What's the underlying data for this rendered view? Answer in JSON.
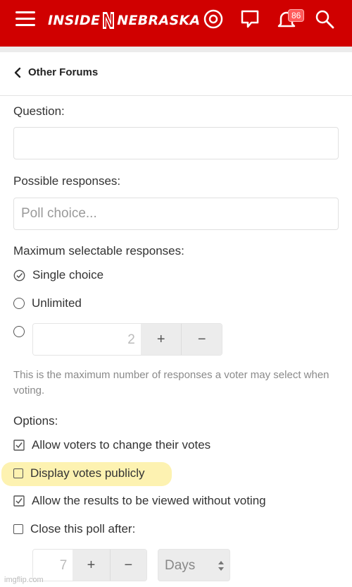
{
  "header": {
    "logo_left": "INSIDE",
    "logo_right": "NEBRASKA",
    "notification_count": "86",
    "icons": [
      "menu-icon",
      "account-icon",
      "conversations-icon",
      "alerts-icon",
      "search-icon"
    ]
  },
  "breadcrumb": {
    "label": "Other Forums"
  },
  "form": {
    "question_label": "Question:",
    "question_value": "",
    "responses_label": "Possible responses:",
    "poll_choice_placeholder": "Poll choice...",
    "max_label": "Maximum selectable responses:",
    "single_choice": "Single choice",
    "unlimited": "Unlimited",
    "max_value": "2",
    "plus": "+",
    "minus": "−",
    "help_text": "This is the maximum number of responses a voter may select when voting.",
    "options_label": "Options:",
    "opt_change_votes": "Allow voters to change their votes",
    "opt_display_public": "Display votes publicly",
    "opt_view_results": "Allow the results to be viewed without voting",
    "opt_close_after": "Close this poll after:",
    "close_value": "7",
    "close_unit": "Days"
  },
  "watermark": "imgflip.com",
  "colors": {
    "brand_red": "#d00000",
    "highlight": "#fdf1a8"
  }
}
